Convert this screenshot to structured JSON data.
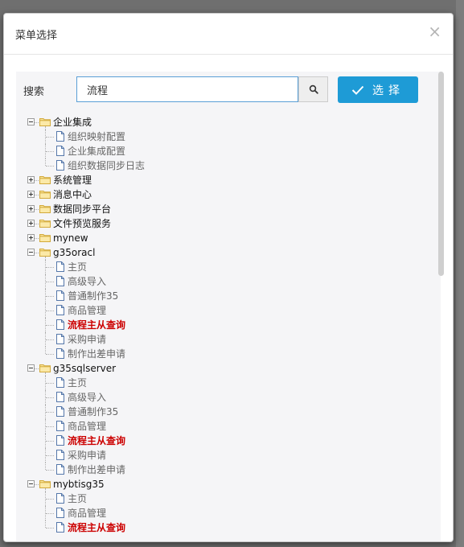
{
  "dialog": {
    "title": "菜单选择",
    "close_icon": "×"
  },
  "search": {
    "label": "搜索",
    "value": "流程",
    "button_icon": "magnifier-icon"
  },
  "select_button": {
    "label": "选择",
    "icon": "checkmark-icon",
    "color": "#1e9bd6"
  },
  "highlight_color": "#cc0000",
  "tree": [
    {
      "type": "folder",
      "depth": 0,
      "expanded": true,
      "label": "企业集成"
    },
    {
      "type": "leaf",
      "depth": 1,
      "label": "组织映射配置"
    },
    {
      "type": "leaf",
      "depth": 1,
      "label": "企业集成配置"
    },
    {
      "type": "leaf",
      "depth": 1,
      "label": "组织数据同步日志"
    },
    {
      "type": "folder",
      "depth": 0,
      "expanded": false,
      "label": "系统管理"
    },
    {
      "type": "folder",
      "depth": 0,
      "expanded": false,
      "label": "消息中心"
    },
    {
      "type": "folder",
      "depth": 0,
      "expanded": false,
      "label": "数据同步平台"
    },
    {
      "type": "folder",
      "depth": 0,
      "expanded": false,
      "label": "文件预览服务"
    },
    {
      "type": "folder",
      "depth": 0,
      "expanded": false,
      "label": "mynew"
    },
    {
      "type": "folder",
      "depth": 0,
      "expanded": true,
      "label": "g35oracl"
    },
    {
      "type": "leaf",
      "depth": 1,
      "label": "主页"
    },
    {
      "type": "leaf",
      "depth": 1,
      "label": "高级导入"
    },
    {
      "type": "leaf",
      "depth": 1,
      "label": "普通制作35"
    },
    {
      "type": "leaf",
      "depth": 1,
      "label": "商品管理"
    },
    {
      "type": "leaf",
      "depth": 1,
      "label": "流程主从查询",
      "highlight": true
    },
    {
      "type": "leaf",
      "depth": 1,
      "label": "采购申请"
    },
    {
      "type": "leaf",
      "depth": 1,
      "label": "制作出差申请"
    },
    {
      "type": "folder",
      "depth": 0,
      "expanded": true,
      "label": "g35sqlserver"
    },
    {
      "type": "leaf",
      "depth": 1,
      "label": "主页"
    },
    {
      "type": "leaf",
      "depth": 1,
      "label": "高级导入"
    },
    {
      "type": "leaf",
      "depth": 1,
      "label": "普通制作35"
    },
    {
      "type": "leaf",
      "depth": 1,
      "label": "商品管理"
    },
    {
      "type": "leaf",
      "depth": 1,
      "label": "流程主从查询",
      "highlight": true
    },
    {
      "type": "leaf",
      "depth": 1,
      "label": "采购申请"
    },
    {
      "type": "leaf",
      "depth": 1,
      "label": "制作出差申请"
    },
    {
      "type": "folder",
      "depth": 0,
      "expanded": true,
      "label": "mybtisg35"
    },
    {
      "type": "leaf",
      "depth": 1,
      "label": "主页"
    },
    {
      "type": "leaf",
      "depth": 1,
      "label": "商品管理"
    },
    {
      "type": "leaf",
      "depth": 1,
      "label": "流程主从查询",
      "highlight": true
    }
  ]
}
